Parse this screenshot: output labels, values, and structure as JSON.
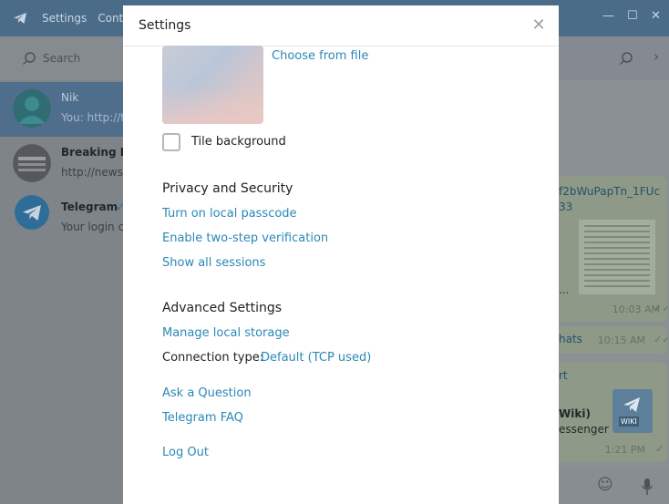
{
  "window": {
    "menu": [
      "Settings",
      "Conta"
    ],
    "search_placeholder": "Search"
  },
  "dialogs": [
    {
      "name": "Nik",
      "preview": "You: http://t",
      "selected": true
    },
    {
      "name": "Breaking N",
      "preview": "http://news.",
      "selected": false
    },
    {
      "name": "Telegram",
      "preview": "Your login c",
      "selected": false
    }
  ],
  "chat": {
    "bubble1_text": "f2bWuPapTn_1FUc",
    "bubble1_text2": "33",
    "bubble1_ellipsis": "...",
    "bubble1_time": "10:03 AM",
    "bubble2_text": "hats",
    "bubble2_time": "10:15 AM",
    "bubble3_top": "rt",
    "bubble3_line1": "Wiki)",
    "bubble3_line2": "essenger",
    "bubble3_badge": "WIKI",
    "bubble3_time": "1:21 PM"
  },
  "settings": {
    "title": "Settings",
    "close_symbol": "✕",
    "choose_from_file": "Choose from file",
    "tile_background": "Tile background",
    "privacy_header": "Privacy and Security",
    "local_passcode": "Turn on local passcode",
    "two_step": "Enable two-step verification",
    "show_sessions": "Show all sessions",
    "advanced_header": "Advanced Settings",
    "manage_storage": "Manage local storage",
    "connection_label": "Connection type:",
    "connection_value": "Default (TCP used)",
    "ask_question": "Ask a Question",
    "faq": "Telegram FAQ",
    "logout": "Log Out"
  },
  "colors": {
    "accent": "#2a88b8",
    "titlebar": "#4b6c88"
  }
}
